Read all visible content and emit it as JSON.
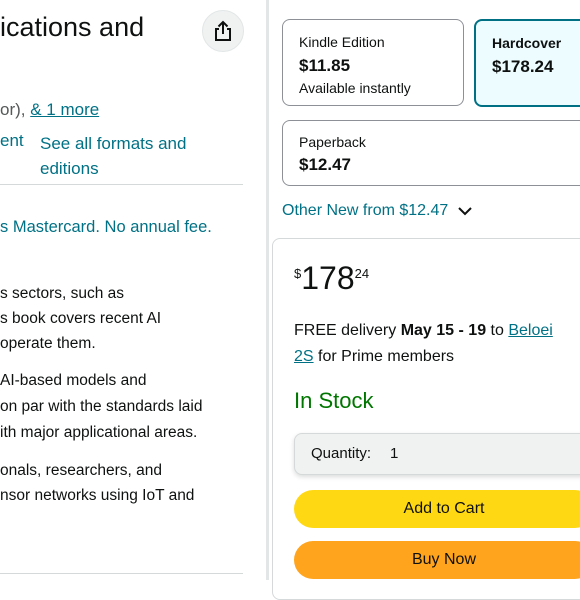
{
  "product": {
    "title_fragment": "ications and",
    "byline": {
      "prefix": "or), ",
      "more_link": "& 1 more"
    },
    "format_fragment": "ent",
    "see_all_formats": "See all formats and editions",
    "card_promo": "s Mastercard. No annual fee.",
    "description": [
      "s sectors, such as",
      "s book covers recent AI",
      "operate them.",
      "AI-based models and",
      "on par with the standards laid",
      "ith major applicational areas.",
      "onals, researchers, and",
      "nsor networks using IoT and"
    ]
  },
  "formats": [
    {
      "name": "Kindle Edition",
      "price": "$11.85",
      "sub": "Available instantly",
      "selected": false
    },
    {
      "name": "Hardcover",
      "price": "$178.24",
      "sub": "",
      "selected": true
    },
    {
      "name": "Paperback",
      "price": "$12.47",
      "sub": "",
      "selected": false
    }
  ],
  "other_new": "Other New from $12.47",
  "buybox": {
    "price_symbol": "$",
    "price_whole": "178",
    "price_fraction": "24",
    "delivery_prefix": "FREE delivery ",
    "delivery_dates": "May 15 - 19",
    "delivery_to": " to ",
    "delivery_location_line1": "Beloei",
    "delivery_location_line2": "2S",
    "delivery_suffix": " for Prime members",
    "stock_status": "In Stock",
    "quantity_label": "Quantity:",
    "quantity_value": "1",
    "add_to_cart": "Add to Cart",
    "buy_now": "Buy Now"
  },
  "colors": {
    "link": "#007185",
    "in_stock": "#007600",
    "add_to_cart": "#ffd814",
    "buy_now": "#ffa41c",
    "selected_format_bg": "#edfdff"
  }
}
